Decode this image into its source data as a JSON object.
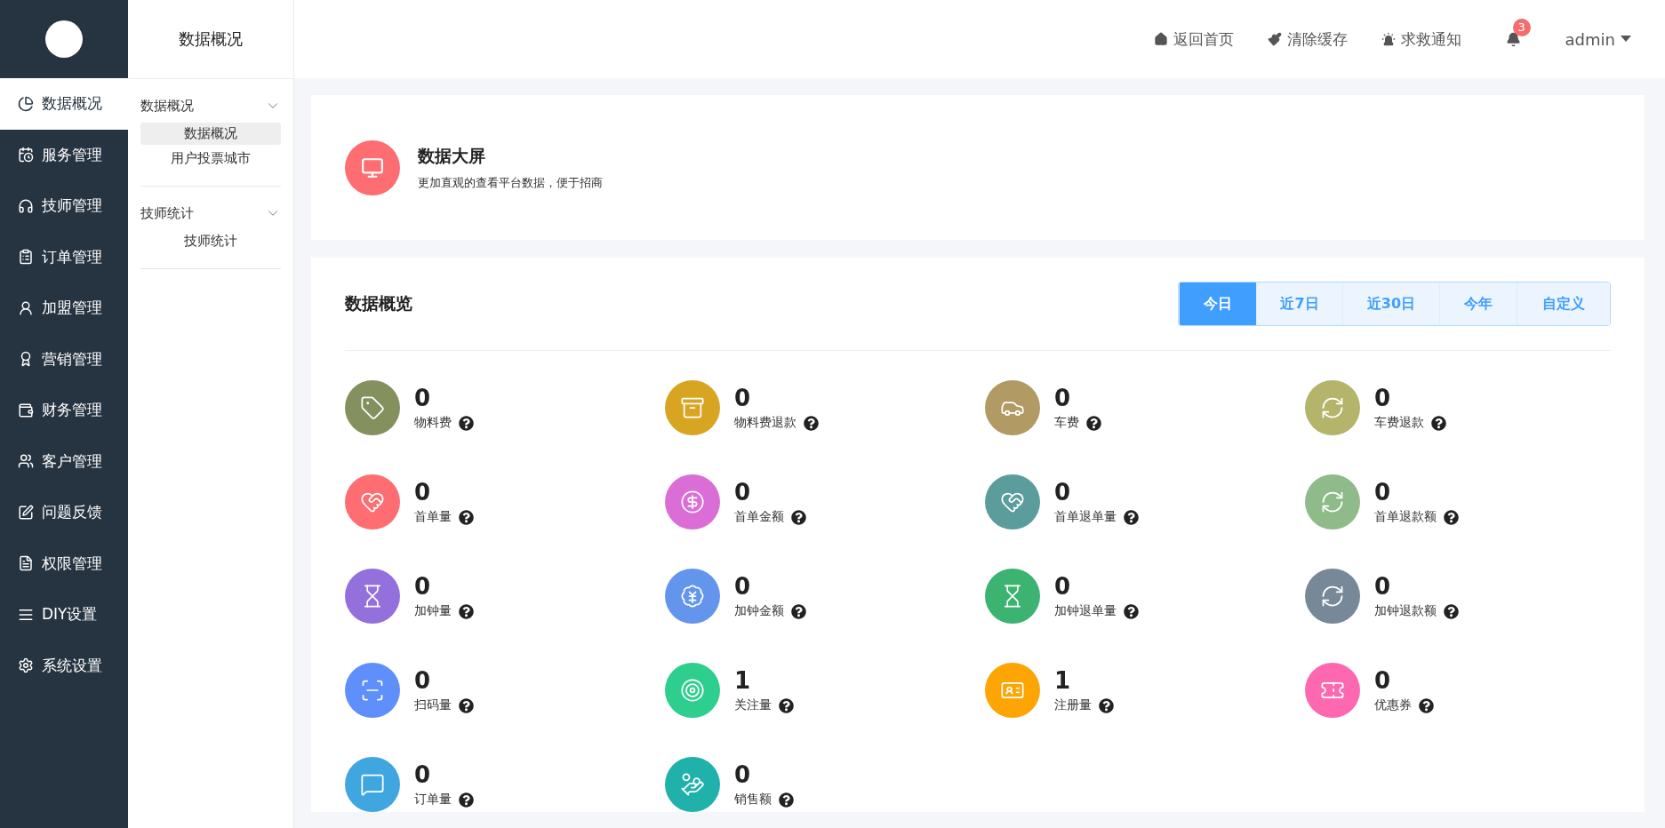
{
  "sidebar": {
    "items": [
      {
        "label": "数据概况",
        "selected": true
      },
      {
        "label": "服务管理",
        "selected": false
      },
      {
        "label": "技师管理",
        "selected": false
      },
      {
        "label": "订单管理",
        "selected": false
      },
      {
        "label": "加盟管理",
        "selected": false
      },
      {
        "label": "营销管理",
        "selected": false
      },
      {
        "label": "财务管理",
        "selected": false
      },
      {
        "label": "客户管理",
        "selected": false
      },
      {
        "label": "问题反馈",
        "selected": false
      },
      {
        "label": "权限管理",
        "selected": false
      },
      {
        "label": "DIY设置",
        "selected": false
      },
      {
        "label": "系统设置",
        "selected": false
      }
    ]
  },
  "subnav": {
    "title": "数据概况",
    "groups": [
      {
        "label": "数据概况",
        "expanded": true,
        "children": [
          {
            "label": "数据概况",
            "selected": true
          },
          {
            "label": "用户投票城市",
            "selected": false
          }
        ]
      },
      {
        "label": "技师统计",
        "expanded": true,
        "children": [
          {
            "label": "技师统计",
            "selected": false
          }
        ]
      }
    ]
  },
  "header": {
    "links": [
      "返回首页",
      "清除缓存",
      "求救通知"
    ],
    "notification_count": "3",
    "user": "admin"
  },
  "banner": {
    "title": "数据大屏",
    "description": "更加直观的查看平台数据，便于招商"
  },
  "overview": {
    "title": "数据概览",
    "tabs": [
      {
        "label": "今日",
        "selected": true
      },
      {
        "label": "近7日",
        "selected": false
      },
      {
        "label": "近30日",
        "selected": false
      },
      {
        "label": "今年",
        "selected": false
      },
      {
        "label": "自定义",
        "selected": false
      }
    ],
    "stats": [
      {
        "value": "0",
        "label": "物料费",
        "color": "#84915f"
      },
      {
        "value": "0",
        "label": "物料费退款",
        "color": "#d8a523"
      },
      {
        "value": "0",
        "label": "车费",
        "color": "#b19a63"
      },
      {
        "value": "0",
        "label": "车费退款",
        "color": "#b5b46b"
      },
      {
        "value": "0",
        "label": "首单量",
        "color": "#fd6d71"
      },
      {
        "value": "0",
        "label": "首单金额",
        "color": "#db6ed6"
      },
      {
        "value": "0",
        "label": "首单退单量",
        "color": "#5b9c9c"
      },
      {
        "value": "0",
        "label": "首单退款额",
        "color": "#8ebb89"
      },
      {
        "value": "0",
        "label": "加钟量",
        "color": "#9370db"
      },
      {
        "value": "0",
        "label": "加钟金额",
        "color": "#6495ed"
      },
      {
        "value": "0",
        "label": "加钟退单量",
        "color": "#3cb371"
      },
      {
        "value": "0",
        "label": "加钟退款额",
        "color": "#778899"
      },
      {
        "value": "0",
        "label": "扫码量",
        "color": "#5f8ffb"
      },
      {
        "value": "1",
        "label": "关注量",
        "color": "#2ecf8e"
      },
      {
        "value": "1",
        "label": "注册量",
        "color": "#fca504"
      },
      {
        "value": "0",
        "label": "优惠券",
        "color": "#fe68b1"
      },
      {
        "value": "0",
        "label": "订单量",
        "color": "#40a6df"
      },
      {
        "value": "0",
        "label": "销售额",
        "color": "#20b2aa"
      }
    ]
  }
}
